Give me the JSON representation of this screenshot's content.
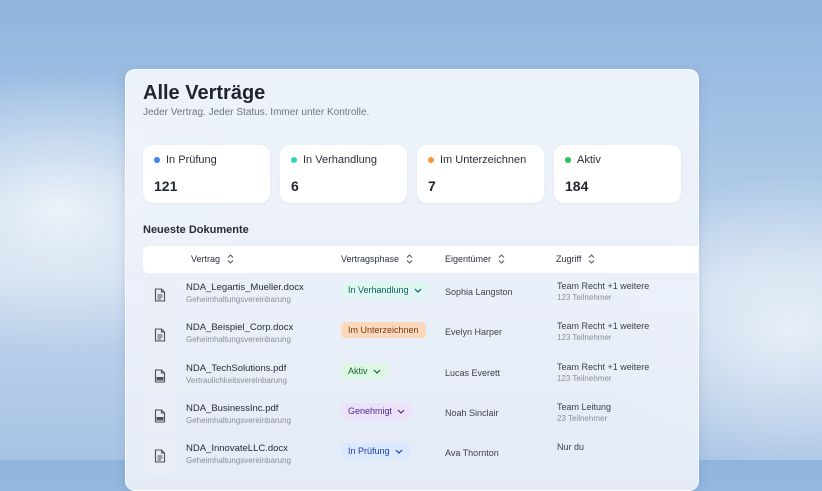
{
  "header": {
    "title": "Alle Verträge",
    "subtitle": "Jeder Vertrag. Jeder Status. Immer unter Kontrolle."
  },
  "stats": [
    {
      "label": "In Prüfung",
      "value": "121",
      "color": "#3b82f6"
    },
    {
      "label": "In Verhandlung",
      "value": "6",
      "color": "#2dd4bf"
    },
    {
      "label": "Im Unterzeichnen",
      "value": "7",
      "color": "#fb923c"
    },
    {
      "label": "Aktiv",
      "value": "184",
      "color": "#22c55e"
    }
  ],
  "section_title": "Neueste Dokumente",
  "table": {
    "columns": [
      "Vertrag",
      "Vertragsphase",
      "Eigentümer",
      "Zugriff"
    ],
    "rows": [
      {
        "file": "NDA_Legartis_Mueller.docx",
        "type": "Geheimhaltungsvereinbarung",
        "icon": "docx-file-icon",
        "phase": "In Verhandlung",
        "phase_bg": "#dff7f3",
        "phase_fg": "#0f5e55",
        "has_chevron": true,
        "owner": "Sophia Langston",
        "access": "Team Recht +1 weitere",
        "members": "123 Teilnehmer"
      },
      {
        "file": "NDA_Beispiel_Corp.docx",
        "type": "Geheimhaltungsvereinbarung",
        "icon": "docx-file-icon",
        "phase": "Im Unterzeichnen",
        "phase_bg": "#fcd9bd",
        "phase_fg": "#7a3a0c",
        "has_chevron": false,
        "owner": "Evelyn Harper",
        "access": "Team Recht +1 weitere",
        "members": "123 Teilnehmer"
      },
      {
        "file": "NDA_TechSolutions.pdf",
        "type": "Vertraulichkeitsvereinbarung",
        "icon": "pdf-file-icon",
        "phase": "Aktiv",
        "phase_bg": "#dcf7e3",
        "phase_fg": "#16632f",
        "has_chevron": true,
        "owner": "Lucas Everett",
        "access": "Team Recht +1 weitere",
        "members": "123 Teilnehmer"
      },
      {
        "file": "NDA_BusinessInc.pdf",
        "type": "Geheimhaltungsvereinbarung",
        "icon": "pdf-file-icon",
        "phase": "Genehmigt",
        "phase_bg": "#ece3fb",
        "phase_fg": "#4c2a8a",
        "has_chevron": true,
        "owner": "Noah Sinclair",
        "access": "Team Leitung",
        "members": "23 Teilnehmer"
      },
      {
        "file": "NDA_InnovateLLC.docx",
        "type": "Geheimhaltungsvereinbarung",
        "icon": "docx-file-icon",
        "phase": "In Prüfung",
        "phase_bg": "#dbe8fd",
        "phase_fg": "#1e40af",
        "has_chevron": true,
        "owner": "Ava Thornton",
        "access": "Nur du",
        "members": ""
      }
    ]
  }
}
